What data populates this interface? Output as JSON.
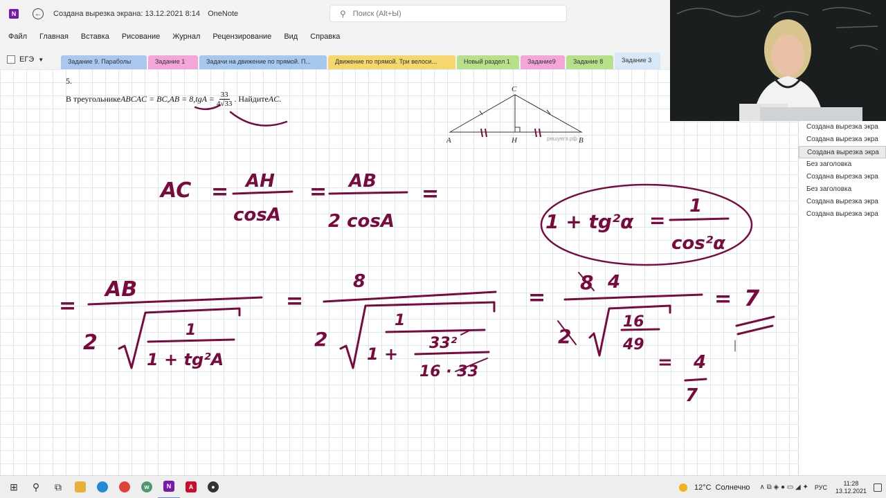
{
  "window": {
    "app_badge": "N",
    "title": "Создана вырезка экрана: 13.12.2021 8:14",
    "app_name": "OneNote",
    "search_placeholder": "Поиск (Alt+Ы)"
  },
  "menu": [
    "Файл",
    "Главная",
    "Вставка",
    "Рисование",
    "Журнал",
    "Рецензирование",
    "Вид",
    "Справка"
  ],
  "notebook": {
    "name": "ЕГЭ"
  },
  "section_tabs": [
    {
      "label": "Задание 9. Параболы",
      "color": "#a9c7ef",
      "active": false
    },
    {
      "label": "Задание 1",
      "color": "#f4a6d8",
      "active": false
    },
    {
      "label": "Задачи на движение по прямой. П...",
      "color": "#a6c8ef",
      "active": false
    },
    {
      "label": "Движение по прямой. Три велоси...",
      "color": "#f5d76e",
      "active": false
    },
    {
      "label": "Новый раздел 1",
      "color": "#b7e08b",
      "active": false
    },
    {
      "label": "Задание9",
      "color": "#f4a6d8",
      "active": false
    },
    {
      "label": "Задание 8",
      "color": "#b7e08b",
      "active": false
    },
    {
      "label": "Задание 3",
      "color": "#c9def6",
      "active": true
    }
  ],
  "problem": {
    "number": "5.",
    "text_before": "В треугольнике ",
    "abc": "ABC",
    "ac_bc": " AC = BC,",
    "ab": " AB = 8,",
    "tga": " tgA = ",
    "frac_num": "33",
    "frac_den": "4√33",
    "text_after": ". Найдите ",
    "ask": "AC",
    "dot": "."
  },
  "figure": {
    "labels": {
      "A": "A",
      "B": "B",
      "C": "C",
      "H": "H"
    },
    "watermark": "решуегэ.рф"
  },
  "handwriting": {
    "ink_color": "#7a0a3c",
    "line1": {
      "left": "AC",
      "eq": "=",
      "f1_num": "AH",
      "f1_den": "cosA",
      "f2_num": "AB",
      "f2_den": "2 cosA"
    },
    "identity": {
      "lhs": "1 + tg²α",
      "eq": "=",
      "num": "1",
      "den": "cos²α"
    },
    "line2": {
      "f1_num": "AB",
      "f1_coef": "2",
      "f1_inner_num": "1",
      "f1_inner_den": "1 + tg²A",
      "f2_num": "8",
      "f2_coef": "2",
      "f2_inner_num": "1",
      "f2_inner_den_a": "1 +",
      "f2_inner_den_b_num": "33²",
      "f2_inner_den_b_den": "16 · 33",
      "f3_num_crossed": "8",
      "f3_num": "4",
      "f3_coef": "2",
      "f3_inner_num": "16",
      "f3_inner_den": "49",
      "result": "7",
      "side_eq": "=",
      "side_num": "4",
      "side_den": "7"
    }
  },
  "page_list": [
    {
      "label": "Создана вырезка экра",
      "selected": false
    },
    {
      "label": "Создана вырезка экра",
      "selected": false
    },
    {
      "label": "Создана вырезка экра",
      "selected": true
    },
    {
      "label": "Без заголовка",
      "selected": false
    },
    {
      "label": "Создана вырезка экра",
      "selected": false
    },
    {
      "label": "Без заголовка",
      "selected": false
    },
    {
      "label": "Создана вырезка экра",
      "selected": false
    },
    {
      "label": "Создана вырезка экра",
      "selected": false
    }
  ],
  "taskbar": {
    "apps": [
      {
        "name": "start-icon",
        "glyph": "⊞",
        "tile": ""
      },
      {
        "name": "search-icon",
        "glyph": "⚲",
        "tile": ""
      },
      {
        "name": "task-view-icon",
        "glyph": "⧉",
        "tile": ""
      },
      {
        "name": "file-explorer-icon",
        "glyph": "",
        "tile": "#e8b23a"
      },
      {
        "name": "edge-icon",
        "glyph": "",
        "tile": "#1f8ad8"
      },
      {
        "name": "chrome-icon",
        "glyph": "",
        "tile": "#db4437"
      },
      {
        "name": "whiteboard-icon",
        "glyph": "w",
        "tile": "#4c9a6a"
      },
      {
        "name": "onenote-icon",
        "glyph": "N",
        "tile": "#7719aa"
      },
      {
        "name": "acrobat-icon",
        "glyph": "A",
        "tile": "#c8102e"
      },
      {
        "name": "obs-icon",
        "glyph": "●",
        "tile": "#333333"
      }
    ],
    "weather_temp": "12°C",
    "weather_text": "Солнечно",
    "tray_icons": "∧  ⧉  ◈  ●  ▭  ◢  ✦",
    "language": "РУС",
    "time": "11:28",
    "date": "13.12.2021"
  }
}
